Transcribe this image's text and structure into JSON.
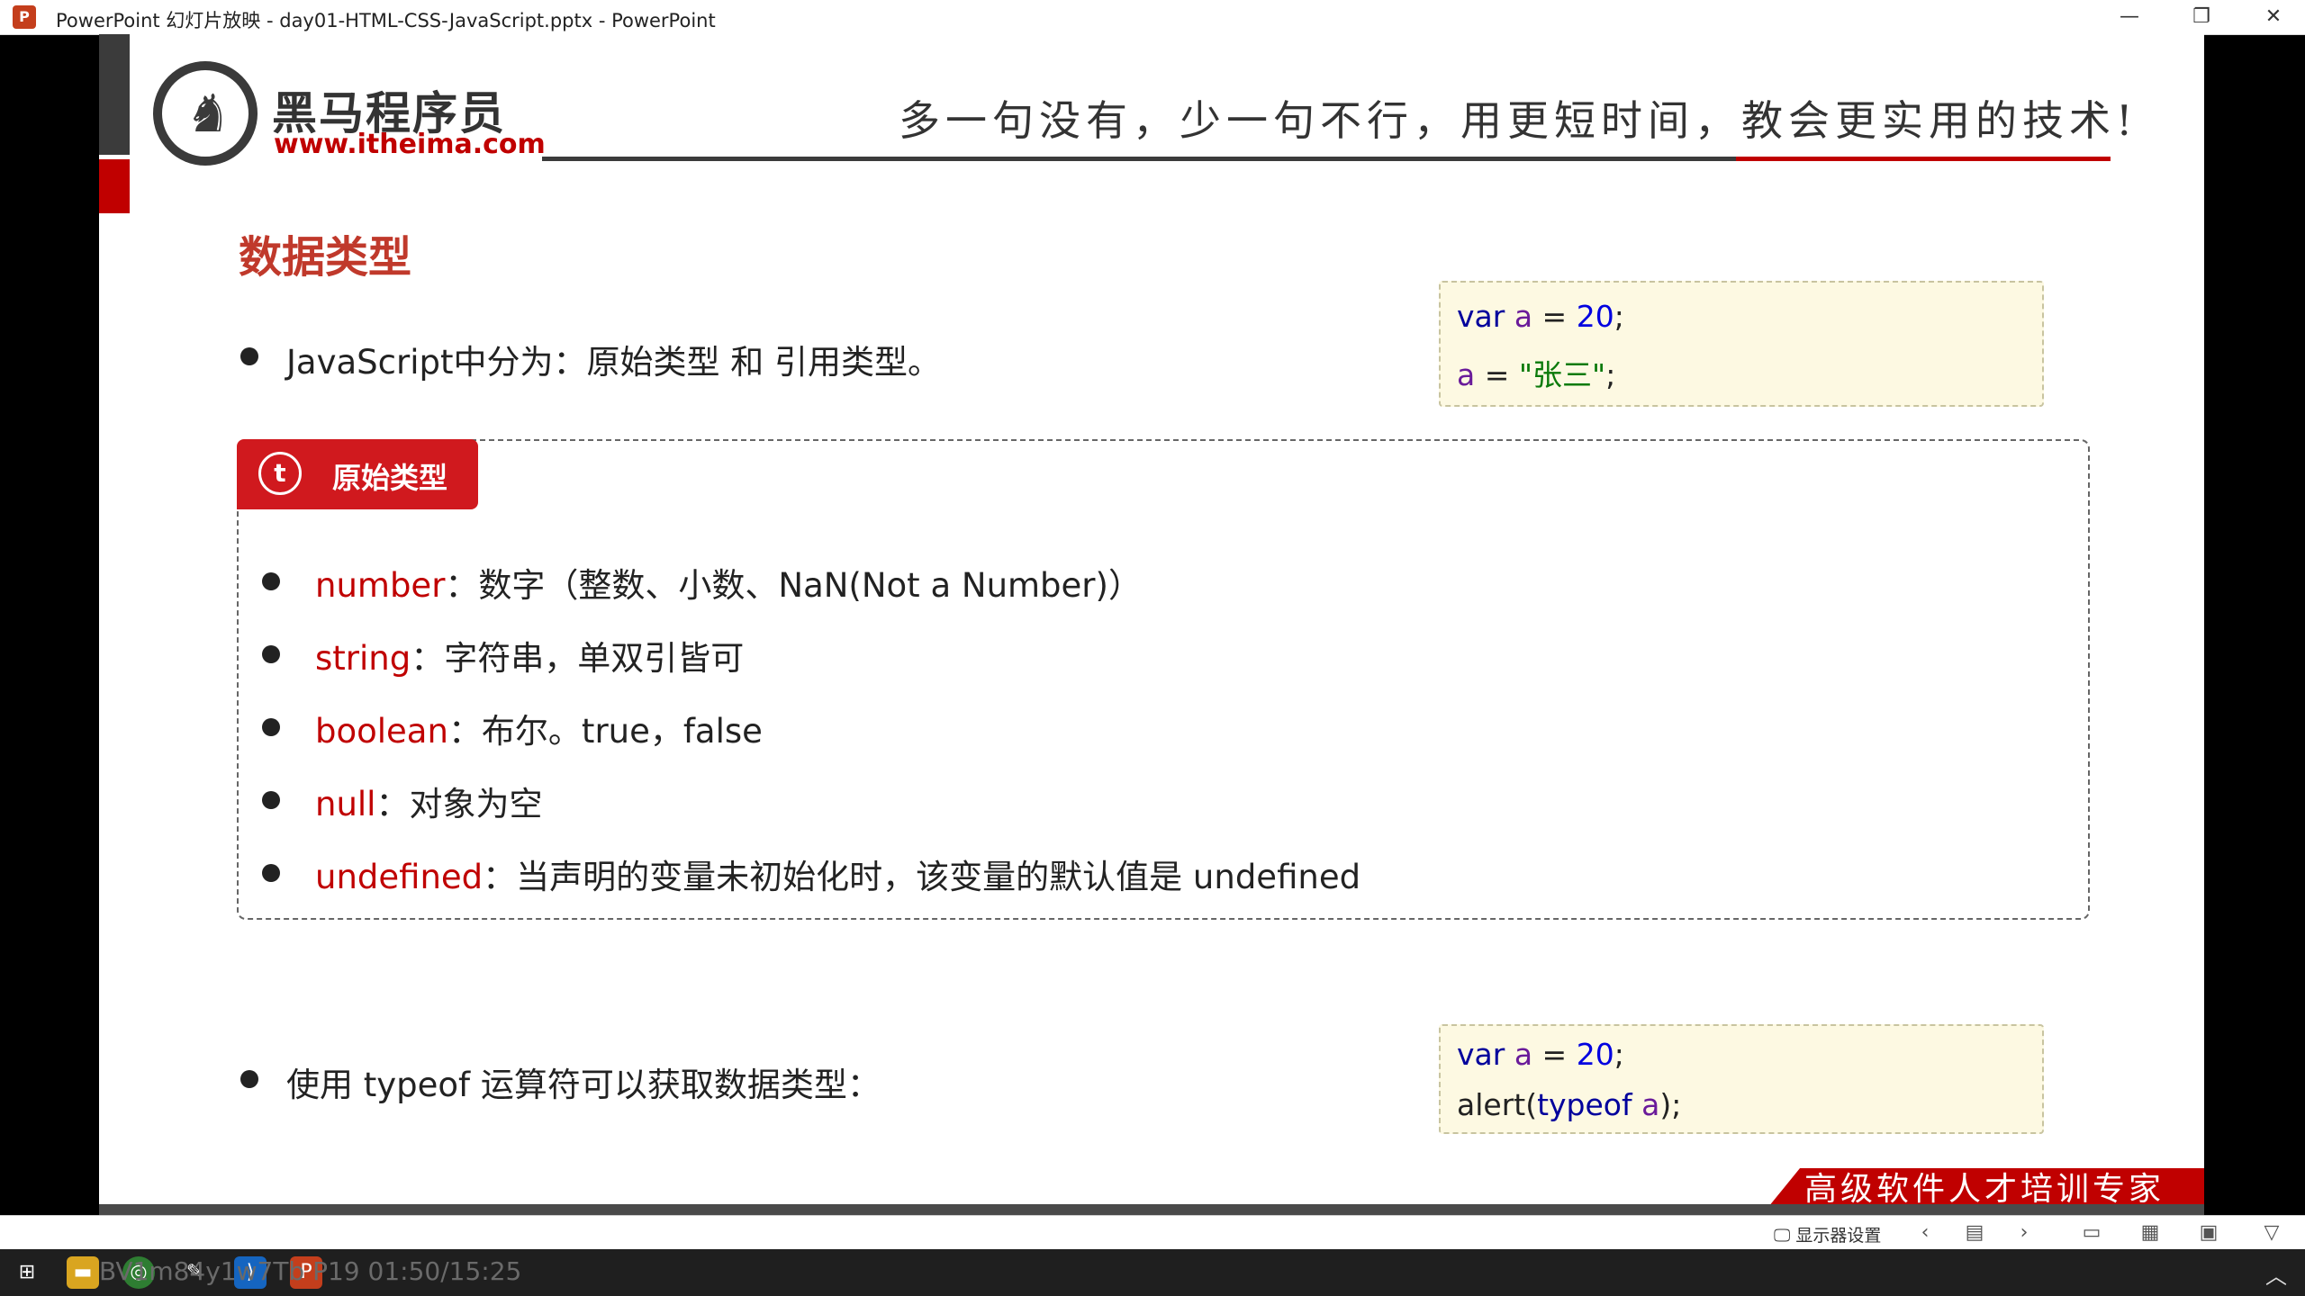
{
  "window": {
    "title": "PowerPoint 幻灯片放映  -  day01-HTML-CSS-JavaScript.pptx - PowerPoint",
    "minimize": "—",
    "restore": "❐",
    "close": "✕"
  },
  "slide": {
    "logo_cn": "黑马程序员",
    "logo_url": "www.itheima.com",
    "slogan": "多一句没有，少一句不行，用更短时间，教会更实用的技术!",
    "heading": "数据类型",
    "intro": "JavaScript中分为：原始类型 和 引用类型。",
    "code1": {
      "l1": {
        "kw": "var",
        "var": "a",
        "eq": " = ",
        "num": "20",
        "end": ";"
      },
      "l2": {
        "var": "a",
        "eq": " = ",
        "str": "\"张三\"",
        "end": ";"
      }
    },
    "panel_tab": {
      "icon": "t",
      "label": "原始类型"
    },
    "items": [
      {
        "key": "number",
        "text": "：数字（整数、小数、NaN(Not a Number)）"
      },
      {
        "key": "string",
        "text": "：字符串，单双引皆可"
      },
      {
        "key": "boolean",
        "text": "：布尔。true，false"
      },
      {
        "key": "null",
        "text": "：对象为空"
      },
      {
        "key": "undefined",
        "text": "：当声明的变量未初始化时，该变量的默认值是 undefined"
      }
    ],
    "typeof_text": "使用 typeof 运算符可以获取数据类型：",
    "code2": {
      "l1": {
        "kw": "var",
        "var": "a",
        "eq": " = ",
        "num": "20",
        "end": ";"
      },
      "l2": {
        "pre": "alert(",
        "kw": "typeof ",
        "var": "a",
        "end": ");"
      }
    },
    "footer_banner": "高级软件人才培训专家"
  },
  "showbar": {
    "display_settings": "显示器设置"
  },
  "taskbar": {
    "watermark": "BV1m84y1w7Tb P19 01:50/15:25"
  },
  "colors": {
    "accent_red": "#c00000",
    "code_bg": "#fdf9e2"
  }
}
